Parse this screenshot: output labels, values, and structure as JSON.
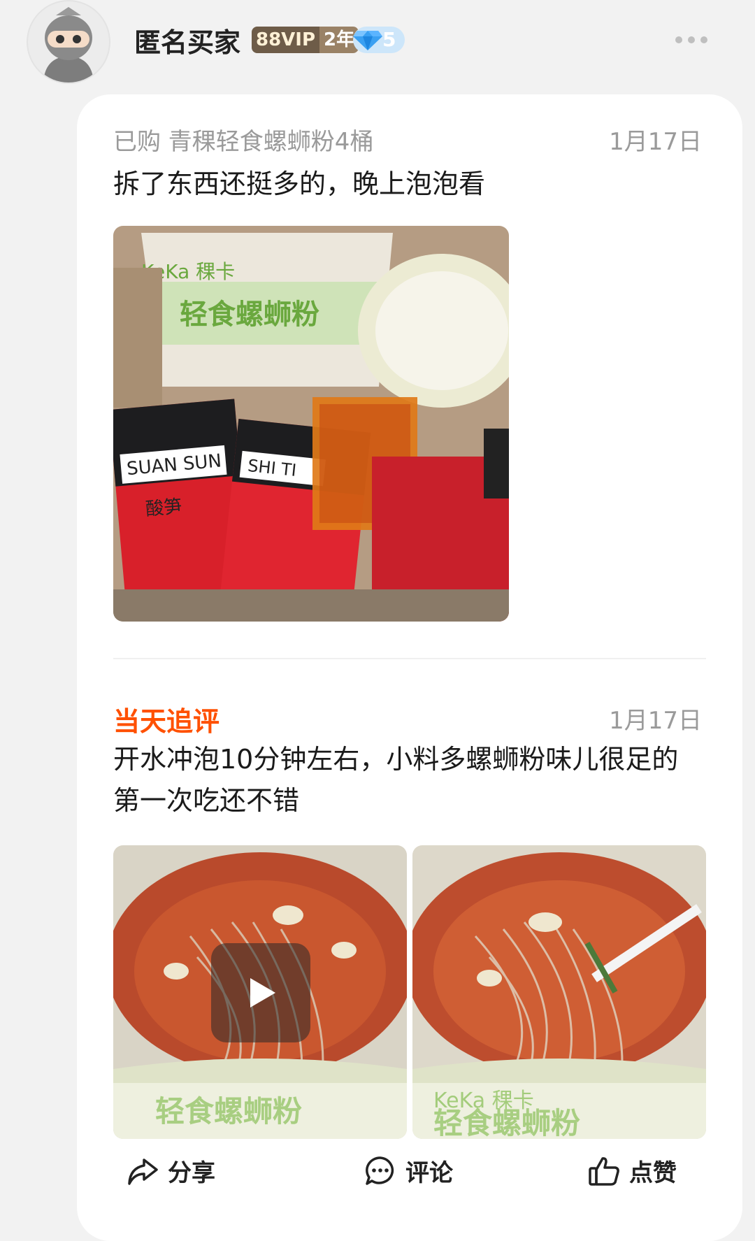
{
  "user": {
    "name": "匿名买家",
    "vip_label": "88VIP",
    "vip_years": "2年",
    "diamond_level": "5"
  },
  "review": {
    "purchased_item": "已购 青稞轻食螺蛳粉4桶",
    "date": "1月17日",
    "text": "拆了东西还挺多的，晚上泡泡看",
    "image_labels": [
      "SUAN SUN",
      "SHI TI",
      "酸笋",
      "轻食螺蛳粉",
      "KeKa 稞卡"
    ]
  },
  "followup": {
    "label": "当天追评",
    "date": "1月17日",
    "text": "开水冲泡10分钟左右，小料多螺蛳粉味儿很足的第一次吃还不错"
  },
  "actions": {
    "share": "分享",
    "comment": "评论",
    "like": "点赞"
  }
}
